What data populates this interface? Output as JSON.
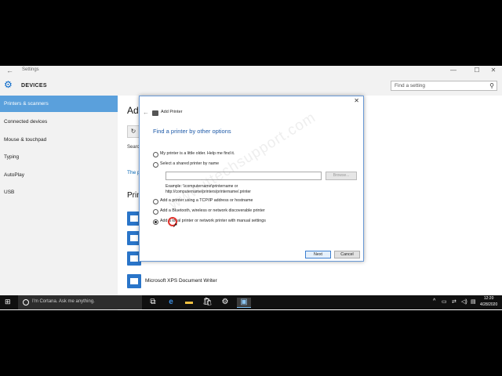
{
  "window": {
    "title": "Settings",
    "back_glyph": "←",
    "controls": {
      "minimize": "—",
      "maximize": "☐",
      "close": "✕"
    }
  },
  "header": {
    "title": "DEVICES",
    "search_placeholder": "Find a setting"
  },
  "sidebar": {
    "items": [
      {
        "label": "Printers & scanners",
        "active": true
      },
      {
        "label": "Connected devices"
      },
      {
        "label": "Mouse & touchpad"
      },
      {
        "label": "Typing"
      },
      {
        "label": "AutoPlay"
      },
      {
        "label": "USB"
      }
    ]
  },
  "main": {
    "heading_fragment": "Add",
    "search_fragment": "Searc",
    "link_fragment": "The p",
    "printers_fragment": "Prin",
    "xps_label": "Microsoft XPS Document Writer"
  },
  "dialog": {
    "title": "Add Printer",
    "heading": "Find a printer by other options",
    "options": [
      {
        "label": "My printer is a little older. Help me find it.",
        "checked": false
      },
      {
        "label": "Select a shared printer by name",
        "checked": false
      },
      {
        "label": "Add a printer using a TCP/IP address or hostname",
        "checked": false
      },
      {
        "label": "Add a Bluetooth, wireless or network discoverable printer",
        "checked": false
      },
      {
        "label": "Add a local printer or network printer with manual settings",
        "checked": true
      }
    ],
    "browse_label": "Browse...",
    "example_line1": "Example: \\\\computername\\printername or",
    "example_line2": "http://computername/printers/printername/.printer",
    "next_label": "Next",
    "cancel_label": "Cancel",
    "close_glyph": "✕",
    "back_glyph": "←"
  },
  "watermark": "www.ittechsupport.com",
  "taskbar": {
    "cortana_placeholder": "I'm Cortana. Ask me anything.",
    "time": "12:20",
    "date": "4/28/2020"
  },
  "icons": [
    "windows-start-icon",
    "cortana-icon",
    "task-view-icon",
    "edge-icon",
    "file-explorer-icon",
    "store-icon",
    "settings-icon",
    "control-panel-icon",
    "printer-icon",
    "gear-icon",
    "search-icon"
  ],
  "colors": {
    "accent": "#5aa0dc",
    "link": "#0063b1",
    "dialog_heading": "#1e5aa8",
    "taskbar": "#101010"
  }
}
